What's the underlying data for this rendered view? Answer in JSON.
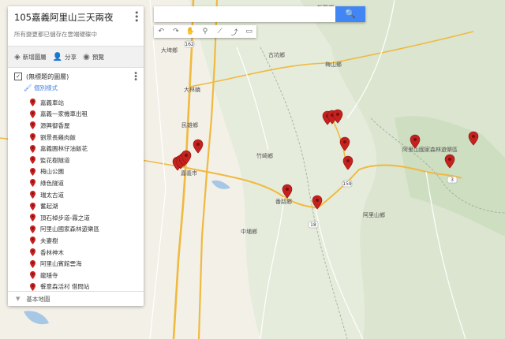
{
  "panel": {
    "title": "105嘉義阿里山三天兩夜",
    "save_status": "所有變更都已儲存在雲端硬碟中",
    "actions": [
      {
        "label": "新增圖層",
        "icon": "layers-icon"
      },
      {
        "label": "分享",
        "icon": "add-person-icon"
      },
      {
        "label": "預覽",
        "icon": "eye-icon"
      }
    ],
    "layer": {
      "name": "(無標題的圖層)",
      "checked": true,
      "style_link": "個別樣式"
    },
    "places": [
      "嘉義車站",
      "嘉義一家機車出租",
      "源興御香屋",
      "劉景長雞肉飯",
      "嘉義圓林仔油飯花",
      "監花樹隧道",
      "梅山公園",
      "綠色隧道",
      "瑞太古道",
      "奮起湖",
      "頂石棹步道-霧之道",
      "阿里山國家森林遊樂區",
      "夫妻樹",
      "香林神木",
      "阿里山賓館雲海",
      "龍隱寺",
      "餐意森活村 借問站"
    ],
    "base_map_label": "基本地圖"
  },
  "search": {
    "placeholder": "",
    "button_icon": "search-icon"
  },
  "toolbar": {
    "tools": [
      "undo-icon",
      "redo-icon",
      "hand-icon",
      "marker-icon",
      "draw-line-icon",
      "directions-icon",
      "ruler-icon"
    ]
  },
  "map": {
    "labels": [
      {
        "text": "大埤鄉"
      },
      {
        "text": "古坑鄉"
      },
      {
        "text": "梅山鄉"
      },
      {
        "text": "大林鎮"
      },
      {
        "text": "民雄鄉"
      },
      {
        "text": "竹崎鄉"
      },
      {
        "text": "番路鄉"
      },
      {
        "text": "嘉義市"
      },
      {
        "text": "中埔鄉"
      },
      {
        "text": "阿里山鄉"
      },
      {
        "text": "阿里山國家森林遊樂區"
      },
      {
        "text": "新興鄉"
      }
    ],
    "route_numbers": [
      "162",
      "159",
      "18",
      "3"
    ],
    "colors": {
      "land": "#e8eee1",
      "plain": "#f2efe7",
      "highway": "#f0b93f",
      "road": "#ffffff",
      "pin": "#c5221f",
      "water": "#a7c7e7"
    }
  }
}
